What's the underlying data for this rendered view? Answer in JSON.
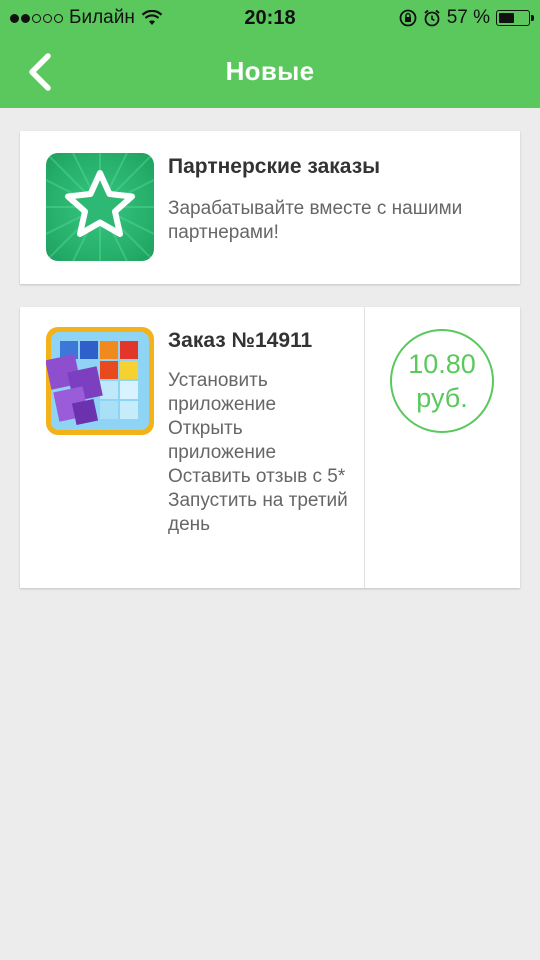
{
  "status_bar": {
    "carrier": "Билайн",
    "signal_level": 2,
    "time": "20:18",
    "battery_percent": "57 %",
    "battery_level": 0.57
  },
  "nav": {
    "title": "Новые",
    "back_icon": "chevron-left-icon"
  },
  "colors": {
    "accent": "#5bc85d",
    "background": "#ececec"
  },
  "partner_card": {
    "icon": "star-icon",
    "title": "Партнерские заказы",
    "subtitle": "Зарабатывайте вместе с нашими партнерами!"
  },
  "order_card": {
    "icon": "game-app-icon",
    "title": "Заказ №14911",
    "tasks": [
      "Установить приложение",
      "Открыть приложение",
      "Оставить отзыв с 5*",
      "Запустить на третий день"
    ],
    "price_amount": "10.80",
    "price_currency": "руб."
  }
}
